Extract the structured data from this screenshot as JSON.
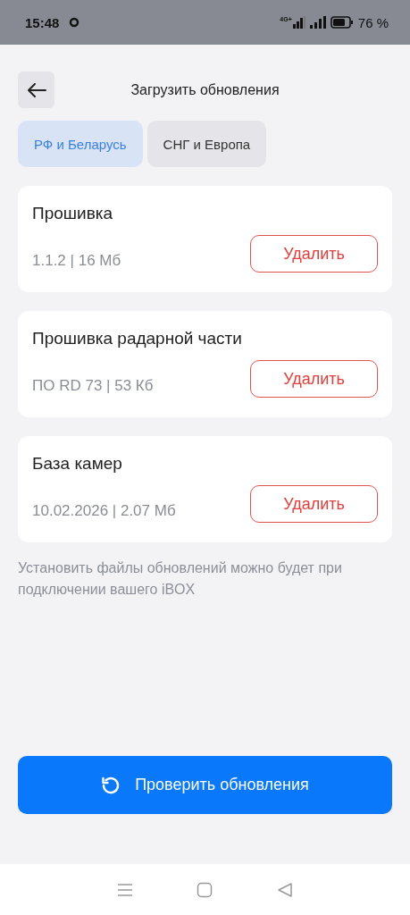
{
  "status_bar": {
    "time": "15:48",
    "network": "4G+",
    "battery_text": "76 %"
  },
  "header": {
    "title": "Загрузить обновления"
  },
  "tabs": [
    {
      "label": "РФ и Беларусь",
      "selected": true
    },
    {
      "label": "СНГ и Европа",
      "selected": false
    }
  ],
  "items": [
    {
      "title": "Прошивка",
      "meta": "1.1.2 | 16 Мб",
      "action": "Удалить"
    },
    {
      "title": "Прошивка радарной части",
      "meta": "ПО RD 73 | 53 Кб",
      "action": "Удалить"
    },
    {
      "title": "База камер",
      "meta": "10.02.2026 | 2.07 Мб",
      "action": "Удалить"
    }
  ],
  "note": "Установить файлы обновлений можно будет при подключении вашего iBOX",
  "primary_button": {
    "label": "Проверить обновления"
  }
}
